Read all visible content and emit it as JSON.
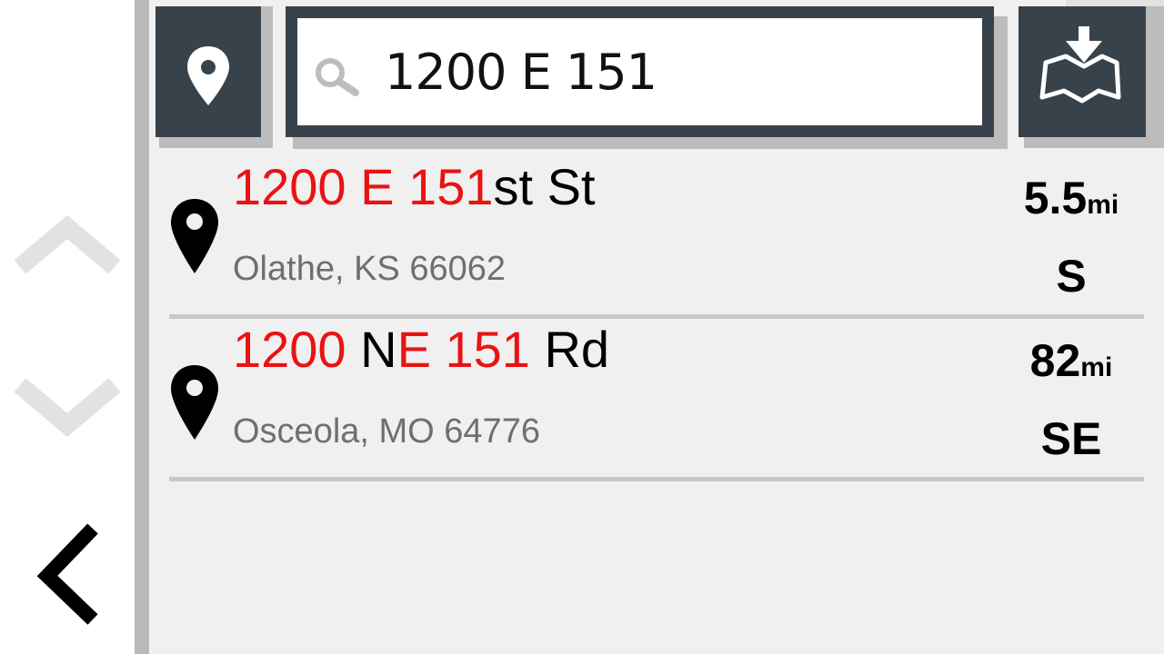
{
  "search": {
    "value": "1200 E 151"
  },
  "results": [
    {
      "title_parts": [
        {
          "text": "1200 E 151",
          "highlight": true
        },
        {
          "text": "st St",
          "highlight": false
        }
      ],
      "subtitle": "Olathe, KS 66062",
      "distance_value": "5.5",
      "distance_unit": "mi",
      "direction": "S"
    },
    {
      "title_parts": [
        {
          "text": "1200",
          "highlight": true
        },
        {
          "text": " N",
          "highlight": false
        },
        {
          "text": "E 151",
          "highlight": true
        },
        {
          "text": " Rd",
          "highlight": false
        }
      ],
      "subtitle": "Osceola, MO 64776",
      "distance_value": "82",
      "distance_unit": "mi",
      "direction": "SE"
    }
  ],
  "colors": {
    "toolbar": "#37424a",
    "highlight": "#ea1212",
    "subtitle": "#6f6f6f",
    "nav_arrows": "#e2e2e2"
  },
  "icons": {
    "location_button": "location-pin-icon",
    "search": "search-icon",
    "map_button": "map-download-icon",
    "result": "location-pin-icon",
    "nav_up": "chevron-up-icon",
    "nav_down": "chevron-down-icon",
    "back": "chevron-left-icon",
    "camera": "camera-icon"
  }
}
